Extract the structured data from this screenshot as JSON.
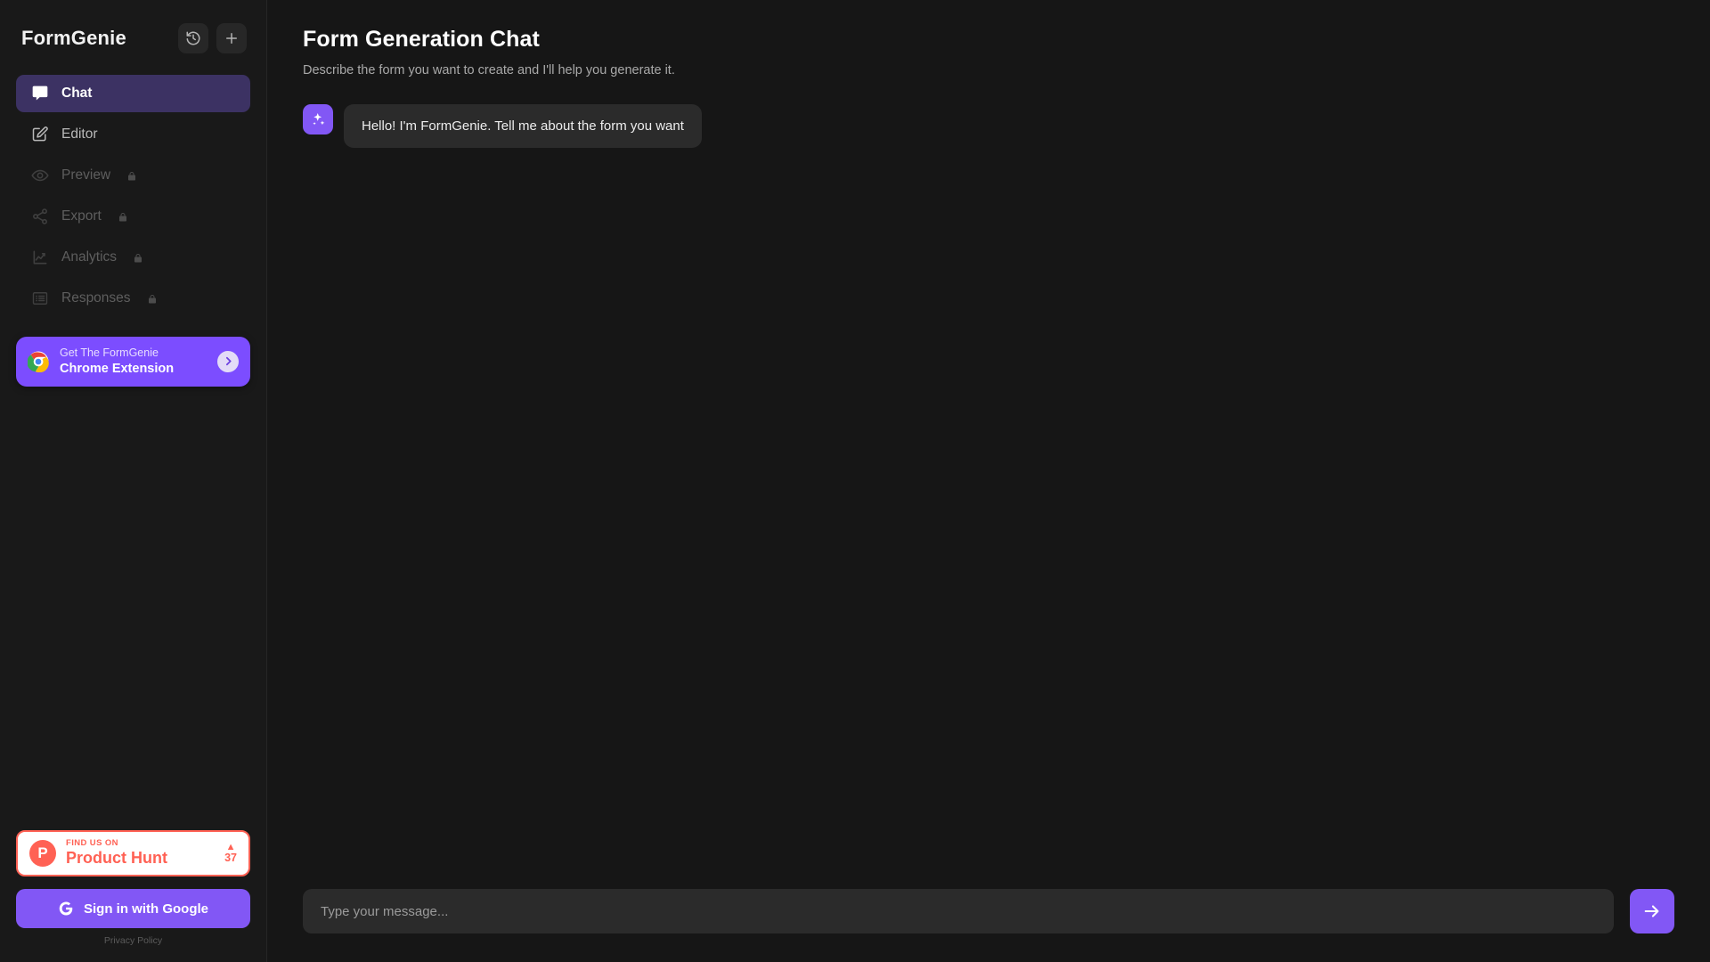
{
  "sidebar": {
    "brand": "FormGenie",
    "header_buttons": [
      {
        "name": "history-button",
        "icon": "history-icon"
      },
      {
        "name": "new-chat-button",
        "icon": "plus-icon"
      }
    ],
    "nav": [
      {
        "label": "Chat",
        "icon": "chat-bubble-icon",
        "active": true,
        "locked": false
      },
      {
        "label": "Editor",
        "icon": "pencil-square-icon",
        "active": false,
        "locked": false
      },
      {
        "label": "Preview",
        "icon": "eye-icon",
        "active": false,
        "locked": true
      },
      {
        "label": "Export",
        "icon": "share-icon",
        "active": false,
        "locked": true
      },
      {
        "label": "Analytics",
        "icon": "chart-line-icon",
        "active": false,
        "locked": true
      },
      {
        "label": "Responses",
        "icon": "list-icon",
        "active": false,
        "locked": true
      }
    ],
    "extension_promo": {
      "line1": "Get The FormGenie",
      "line2": "Chrome Extension",
      "logo_icon": "chrome-logo-icon",
      "chevron_icon": "chevron-right-icon",
      "bg_color": "#7c4dff"
    },
    "product_hunt": {
      "mark": "P",
      "line1": "FIND US ON",
      "line2": "Product Hunt",
      "upvote_arrow": "▲",
      "upvote_count": "37",
      "accent_color": "#ff6154"
    },
    "google_signin": {
      "label": "Sign in with Google",
      "icon": "google-g-icon",
      "bg_color": "#8257f5"
    },
    "privacy_link": "Privacy Policy"
  },
  "main": {
    "title": "Form Generation Chat",
    "subtitle": "Describe the form you want to create and I'll help you generate it.",
    "messages": [
      {
        "role": "assistant",
        "avatar_icon": "sparkles-icon",
        "text": "Hello! I'm FormGenie. Tell me about the form you want"
      }
    ],
    "composer": {
      "placeholder": "Type your message...",
      "value": "",
      "send_icon": "arrow-right-icon",
      "send_color": "#8257f5"
    }
  },
  "theme": {
    "bg": "#161616",
    "sidebar_bg": "#191919",
    "accent": "#8257f5",
    "active_nav_bg": "#3c3263",
    "bubble_bg": "#2b2b2b"
  }
}
